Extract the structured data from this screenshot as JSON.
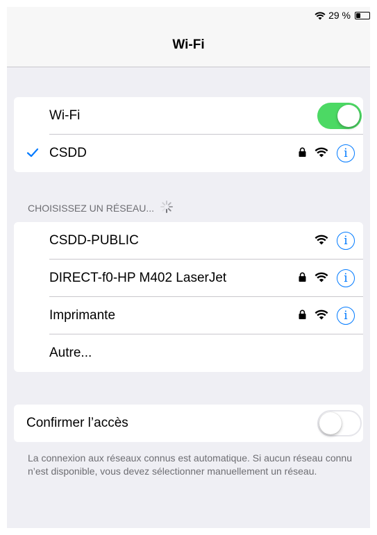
{
  "status_bar": {
    "battery_text": "29 %",
    "battery_level": 0.29
  },
  "nav": {
    "title": "Wi-Fi"
  },
  "wifi_section": {
    "toggle_label": "Wi-Fi",
    "toggle_on": true,
    "connected_network": {
      "name": "CSDD",
      "locked": true,
      "selected": true
    }
  },
  "networks_section": {
    "header": "CHOISISSEZ UN RÉSEAU...",
    "loading": true,
    "networks": [
      {
        "name": "CSDD-PUBLIC",
        "locked": false
      },
      {
        "name": "DIRECT-f0-HP M402 LaserJet",
        "locked": true
      },
      {
        "name": "Imprimante",
        "locked": true
      }
    ],
    "other_label": "Autre..."
  },
  "ask_join": {
    "label": "Confirmer l’accès",
    "toggle_on": false,
    "footer": "La connexion aux réseaux connus est automatique. Si aucun réseau connu n’est disponible, vous devez sélectionner manuellement un réseau."
  },
  "colors": {
    "accent": "#007aff",
    "toggle_on": "#4cd964",
    "background": "#efeff4",
    "section_text": "#6d6d72"
  }
}
